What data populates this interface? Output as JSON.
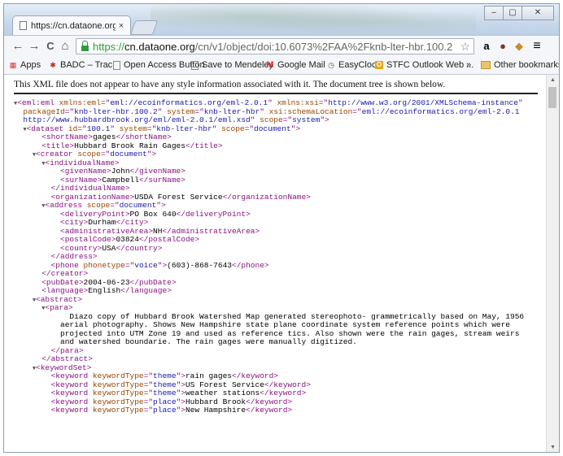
{
  "tab": {
    "title": "https://cn.dataone.org/cn",
    "close": "×"
  },
  "window_controls": {
    "min": "–",
    "max": "▢",
    "close": "✕"
  },
  "toolbar": {
    "back": "←",
    "forward": "→",
    "reload": "C",
    "home": "⌂",
    "url_scheme": "https://",
    "url_domain": "cn.dataone.org",
    "url_path": "/cn/v1/object/doi:10.6073%2FAA%2Fknb-lter-hbr.100.2",
    "star": "☆",
    "menu": "≡"
  },
  "bookmarks": [
    {
      "label": "Apps"
    },
    {
      "label": "BADC – Trac"
    },
    {
      "label": "Open Access Button"
    },
    {
      "label": "Save to Mendeley"
    },
    {
      "label": "Google Mail"
    },
    {
      "label": "EasyClock"
    },
    {
      "label": "STFC Outlook Web ..."
    }
  ],
  "bookmarks_overflow": "»",
  "other_bookmarks": "Other bookmarks",
  "banner": "This XML file does not appear to have any style information associated with it. The document tree is shown below.",
  "xml_lines": [
    {
      "i": 0,
      "t": "▼",
      "p": [
        [
          "tg",
          "<eml:eml "
        ],
        [
          "an",
          "xmlns:eml"
        ],
        [
          "tg",
          "=\""
        ],
        [
          "av",
          "eml://ecoinformatics.org/eml-2.0.1"
        ],
        [
          "tg",
          "\" "
        ],
        [
          "an",
          "xmlns:xsi"
        ],
        [
          "tg",
          "=\""
        ],
        [
          "av",
          "http://www.w3.org/2001/XMLSchema-instance"
        ],
        [
          "tg",
          "\""
        ]
      ]
    },
    {
      "i": 1,
      "t": "",
      "p": [
        [
          "an",
          "packageId"
        ],
        [
          "tg",
          "=\""
        ],
        [
          "av",
          "knb-lter-hbr.100.2"
        ],
        [
          "tg",
          "\" "
        ],
        [
          "an",
          "system"
        ],
        [
          "tg",
          "=\""
        ],
        [
          "av",
          "knb-lter-hbr"
        ],
        [
          "tg",
          "\" "
        ],
        [
          "an",
          "xsi:schemaLocation"
        ],
        [
          "tg",
          "=\""
        ],
        [
          "av",
          "eml://ecoinformatics.org/eml-2.0.1"
        ]
      ]
    },
    {
      "i": 1,
      "t": "",
      "p": [
        [
          "av",
          "http://www.hubbardbrook.org/eml/eml-2.0.1/eml.xsd"
        ],
        [
          "tg",
          "\" "
        ],
        [
          "an",
          "scope"
        ],
        [
          "tg",
          "=\""
        ],
        [
          "av",
          "system"
        ],
        [
          "tg",
          "\">"
        ]
      ]
    },
    {
      "i": 1,
      "t": "▼",
      "p": [
        [
          "tg",
          "<dataset "
        ],
        [
          "an",
          "id"
        ],
        [
          "tg",
          "=\""
        ],
        [
          "av",
          "100.1"
        ],
        [
          "tg",
          "\" "
        ],
        [
          "an",
          "system"
        ],
        [
          "tg",
          "=\""
        ],
        [
          "av",
          "knb-lter-hbr"
        ],
        [
          "tg",
          "\" "
        ],
        [
          "an",
          "scope"
        ],
        [
          "tg",
          "=\""
        ],
        [
          "av",
          "document"
        ],
        [
          "tg",
          "\">"
        ]
      ]
    },
    {
      "i": 3,
      "t": "",
      "p": [
        [
          "tg",
          "<shortName>"
        ],
        [
          "tx",
          "gages"
        ],
        [
          "tg",
          "</shortName>"
        ]
      ]
    },
    {
      "i": 3,
      "t": "",
      "p": [
        [
          "tg",
          "<title>"
        ],
        [
          "tx",
          "Hubbard Brook Rain Gages"
        ],
        [
          "tg",
          "</title>"
        ]
      ]
    },
    {
      "i": 2,
      "t": "▼",
      "p": [
        [
          "tg",
          "<creator "
        ],
        [
          "an",
          "scope"
        ],
        [
          "tg",
          "=\""
        ],
        [
          "av",
          "document"
        ],
        [
          "tg",
          "\">"
        ]
      ]
    },
    {
      "i": 3,
      "t": "▼",
      "p": [
        [
          "tg",
          "<individualName>"
        ]
      ]
    },
    {
      "i": 5,
      "t": "",
      "p": [
        [
          "tg",
          "<givenName>"
        ],
        [
          "tx",
          "John"
        ],
        [
          "tg",
          "</givenName>"
        ]
      ]
    },
    {
      "i": 5,
      "t": "",
      "p": [
        [
          "tg",
          "<surName>"
        ],
        [
          "tx",
          "Campbell"
        ],
        [
          "tg",
          "</surName>"
        ]
      ]
    },
    {
      "i": 4,
      "t": "",
      "p": [
        [
          "tg",
          "</individualName>"
        ]
      ]
    },
    {
      "i": 4,
      "t": "",
      "p": [
        [
          "tg",
          "<organizationName>"
        ],
        [
          "tx",
          "USDA Forest Service"
        ],
        [
          "tg",
          "</organizationName>"
        ]
      ]
    },
    {
      "i": 3,
      "t": "▼",
      "p": [
        [
          "tg",
          "<address "
        ],
        [
          "an",
          "scope"
        ],
        [
          "tg",
          "=\""
        ],
        [
          "av",
          "document"
        ],
        [
          "tg",
          "\">"
        ]
      ]
    },
    {
      "i": 5,
      "t": "",
      "p": [
        [
          "tg",
          "<deliveryPoint>"
        ],
        [
          "tx",
          "PO Box 640"
        ],
        [
          "tg",
          "</deliveryPoint>"
        ]
      ]
    },
    {
      "i": 5,
      "t": "",
      "p": [
        [
          "tg",
          "<city>"
        ],
        [
          "tx",
          "Durham"
        ],
        [
          "tg",
          "</city>"
        ]
      ]
    },
    {
      "i": 5,
      "t": "",
      "p": [
        [
          "tg",
          "<administrativeArea>"
        ],
        [
          "tx",
          "NH"
        ],
        [
          "tg",
          "</administrativeArea>"
        ]
      ]
    },
    {
      "i": 5,
      "t": "",
      "p": [
        [
          "tg",
          "<postalCode>"
        ],
        [
          "tx",
          "03824"
        ],
        [
          "tg",
          "</postalCode>"
        ]
      ]
    },
    {
      "i": 5,
      "t": "",
      "p": [
        [
          "tg",
          "<country>"
        ],
        [
          "tx",
          "USA"
        ],
        [
          "tg",
          "</country>"
        ]
      ]
    },
    {
      "i": 4,
      "t": "",
      "p": [
        [
          "tg",
          "</address>"
        ]
      ]
    },
    {
      "i": 4,
      "t": "",
      "p": [
        [
          "tg",
          "<phone "
        ],
        [
          "an",
          "phonetype"
        ],
        [
          "tg",
          "=\""
        ],
        [
          "av",
          "voice"
        ],
        [
          "tg",
          "\">"
        ],
        [
          "tx",
          "(603)-868-7643"
        ],
        [
          "tg",
          "</phone>"
        ]
      ]
    },
    {
      "i": 3,
      "t": "",
      "p": [
        [
          "tg",
          "</creator>"
        ]
      ]
    },
    {
      "i": 3,
      "t": "",
      "p": [
        [
          "tg",
          "<pubDate>"
        ],
        [
          "tx",
          "2004-06-23"
        ],
        [
          "tg",
          "</pubDate>"
        ]
      ]
    },
    {
      "i": 3,
      "t": "",
      "p": [
        [
          "tg",
          "<language>"
        ],
        [
          "tx",
          "English"
        ],
        [
          "tg",
          "</language>"
        ]
      ]
    },
    {
      "i": 2,
      "t": "▼",
      "p": [
        [
          "tg",
          "<abstract>"
        ]
      ]
    },
    {
      "i": 3,
      "t": "▼",
      "p": [
        [
          "tg",
          "<para>"
        ]
      ]
    },
    {
      "i": 6,
      "t": "",
      "p": [
        [
          "tx",
          "Diazo copy of Hubbard Brook Watershed Map generated stereophoto- grammetrically based on May, 1956"
        ]
      ]
    },
    {
      "i": 5,
      "t": "",
      "p": [
        [
          "tx",
          "aerial photography. Shows New Hampshire state plane coordinate system reference points which were"
        ]
      ]
    },
    {
      "i": 5,
      "t": "",
      "p": [
        [
          "tx",
          "projected into UTM Zone 19 and used as reference tics. Also shown were the rain gages, stream weirs"
        ]
      ]
    },
    {
      "i": 5,
      "t": "",
      "p": [
        [
          "tx",
          "and watershed boundarie. The rain gages were manually digitized."
        ]
      ]
    },
    {
      "i": 4,
      "t": "",
      "p": [
        [
          "tg",
          "</para>"
        ]
      ]
    },
    {
      "i": 3,
      "t": "",
      "p": [
        [
          "tg",
          "</abstract>"
        ]
      ]
    },
    {
      "i": 2,
      "t": "▼",
      "p": [
        [
          "tg",
          "<keywordSet>"
        ]
      ]
    },
    {
      "i": 4,
      "t": "",
      "p": [
        [
          "tg",
          "<keyword "
        ],
        [
          "an",
          "keywordType"
        ],
        [
          "tg",
          "=\""
        ],
        [
          "av",
          "theme"
        ],
        [
          "tg",
          "\">"
        ],
        [
          "tx",
          "rain gages"
        ],
        [
          "tg",
          "</keyword>"
        ]
      ]
    },
    {
      "i": 4,
      "t": "",
      "p": [
        [
          "tg",
          "<keyword "
        ],
        [
          "an",
          "keywordType"
        ],
        [
          "tg",
          "=\""
        ],
        [
          "av",
          "theme"
        ],
        [
          "tg",
          "\">"
        ],
        [
          "tx",
          "US Forest Service"
        ],
        [
          "tg",
          "</keyword>"
        ]
      ]
    },
    {
      "i": 4,
      "t": "",
      "p": [
        [
          "tg",
          "<keyword "
        ],
        [
          "an",
          "keywordType"
        ],
        [
          "tg",
          "=\""
        ],
        [
          "av",
          "theme"
        ],
        [
          "tg",
          "\">"
        ],
        [
          "tx",
          "weather stations"
        ],
        [
          "tg",
          "</keyword>"
        ]
      ]
    },
    {
      "i": 4,
      "t": "",
      "p": [
        [
          "tg",
          "<keyword "
        ],
        [
          "an",
          "keywordType"
        ],
        [
          "tg",
          "=\""
        ],
        [
          "av",
          "place"
        ],
        [
          "tg",
          "\">"
        ],
        [
          "tx",
          "Hubbard Brook"
        ],
        [
          "tg",
          "</keyword>"
        ]
      ]
    },
    {
      "i": 4,
      "t": "",
      "p": [
        [
          "tg",
          "<keyword "
        ],
        [
          "an",
          "keywordType"
        ],
        [
          "tg",
          "=\""
        ],
        [
          "av",
          "place"
        ],
        [
          "tg",
          "\">"
        ],
        [
          "tx",
          "New Hampshire"
        ],
        [
          "tg",
          "</keyword>"
        ]
      ]
    }
  ],
  "colors": {
    "tag": "#881280",
    "attr_name": "#994500",
    "attr_value": "#1a1aa6",
    "lock": "#2e9a3b"
  }
}
